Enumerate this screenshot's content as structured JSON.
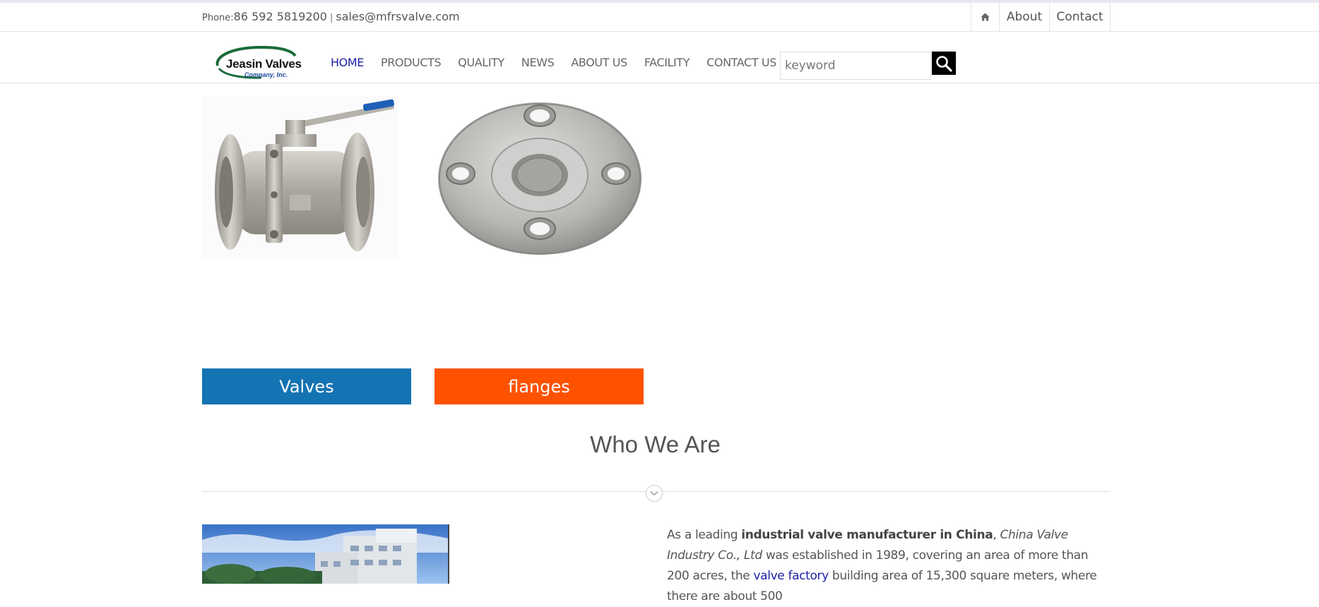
{
  "topbar": {
    "phone_label": "Phone:",
    "phone": "86 592 5819200",
    "separator": "|",
    "email": "sales@mfrsvalve.com",
    "links": [
      {
        "icon": "home-icon"
      },
      {
        "label": "About"
      },
      {
        "label": "Contact"
      }
    ]
  },
  "logo": {
    "brand": "Jeasin Valves",
    "sub": "Company, Inc."
  },
  "nav": {
    "items": [
      "HOME",
      "PRODUCTS",
      "QUALITY",
      "NEWS",
      "ABOUT US",
      "FACILITY",
      "CONTACT US"
    ],
    "active": "HOME"
  },
  "search": {
    "placeholder": "keyword",
    "icon": "search-icon"
  },
  "categories": [
    {
      "label": "Valves",
      "color": "#1473b2"
    },
    {
      "label": "flanges",
      "color": "#fe5200"
    }
  ],
  "section": {
    "title": "Who We Are"
  },
  "about": {
    "t1": "As a leading ",
    "b1": "industrial valve manufacturer in China",
    "t2": ", ",
    "i1": "China Valve Industry Co., Ltd",
    "t3": " was established in 1989, covering an area of more than 200 acres, the ",
    "link": "valve factory",
    "t4": " building area of 15,300 square meters, where there are about 500"
  },
  "colors": {
    "accent_link": "#1c1fa8",
    "valves_blue": "#1473b2",
    "flanges_orange": "#fe5200"
  }
}
